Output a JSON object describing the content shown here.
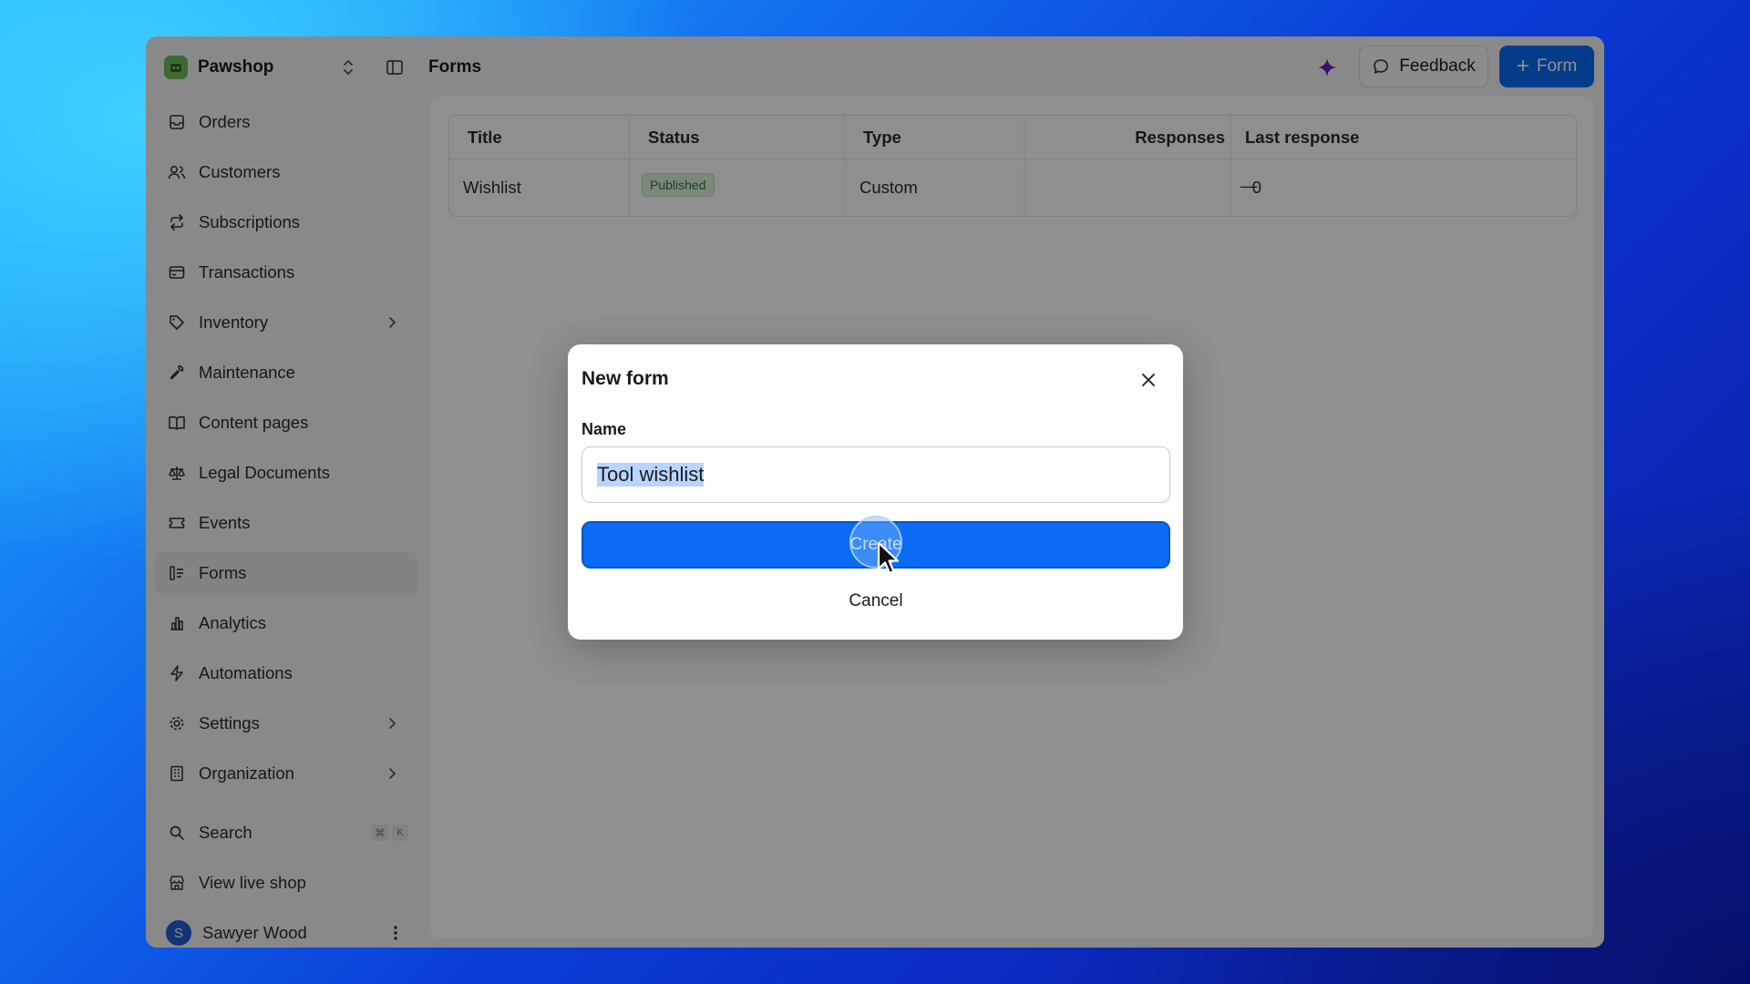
{
  "app": {
    "workspace_name": "Pawshop",
    "page_title": "Forms",
    "feedback_label": "Feedback",
    "new_form_label": "Form"
  },
  "sidebar": {
    "items": [
      {
        "label": "Orders",
        "icon": "inbox-icon"
      },
      {
        "label": "Customers",
        "icon": "users-icon"
      },
      {
        "label": "Subscriptions",
        "icon": "repeat-icon"
      },
      {
        "label": "Transactions",
        "icon": "credit-card-icon"
      },
      {
        "label": "Inventory",
        "icon": "tag-icon"
      },
      {
        "label": "Maintenance",
        "icon": "wrench-icon"
      },
      {
        "label": "Content pages",
        "icon": "book-icon"
      },
      {
        "label": "Legal Documents",
        "icon": "scale-icon"
      },
      {
        "label": "Events",
        "icon": "ticket-icon"
      },
      {
        "label": "Forms",
        "icon": "form-icon"
      },
      {
        "label": "Analytics",
        "icon": "bar-chart-icon"
      },
      {
        "label": "Automations",
        "icon": "bolt-icon"
      },
      {
        "label": "Settings",
        "icon": "gear-icon"
      },
      {
        "label": "Organization",
        "icon": "building-icon"
      }
    ],
    "search_label": "Search",
    "search_shortcut": [
      "⌘",
      "K"
    ],
    "view_shop_label": "View live shop",
    "user": {
      "name": "Sawyer Wood",
      "initial": "S"
    }
  },
  "table": {
    "headers": [
      "Title",
      "Status",
      "Type",
      "Responses",
      "Last response"
    ],
    "rows": [
      {
        "title": "Wishlist",
        "status": "Published",
        "type": "Custom",
        "responses": "0",
        "last_response": "—"
      }
    ]
  },
  "modal": {
    "title": "New form",
    "name_label": "Name",
    "name_value": "Tool wishlist",
    "create_label": "Create",
    "cancel_label": "Cancel"
  },
  "colors": {
    "accent": "#0a6cf5",
    "status_published_bg": "#dff3dd",
    "status_published_text": "#2c7a2a",
    "workspace_logo": "#6bbf5a"
  }
}
